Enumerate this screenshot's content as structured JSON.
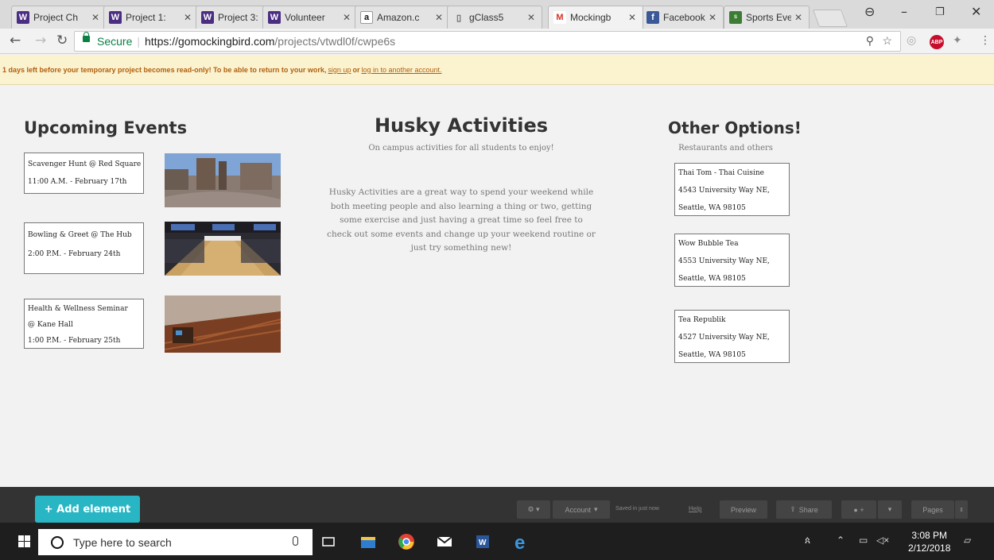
{
  "browser": {
    "tabs": [
      {
        "title": "Project Ch",
        "icon": "uw-w-icon"
      },
      {
        "title": "Project 1:",
        "icon": "uw-w-icon"
      },
      {
        "title": "Project 3:",
        "icon": "uw-w-icon"
      },
      {
        "title": "Volunteer",
        "icon": "uw-w-icon"
      },
      {
        "title": "Amazon.c",
        "icon": "amazon-icon"
      },
      {
        "title": "gClass5",
        "icon": "document-icon"
      },
      {
        "title": "Mockingb",
        "icon": "gmail-icon"
      },
      {
        "title": "Facebook",
        "icon": "facebook-icon"
      },
      {
        "title": "Sports Eve",
        "icon": "sports-icon"
      }
    ],
    "address": {
      "secure_label": "Secure",
      "url_host": "https://gomockingbird.com",
      "url_path": "/projects/vtwdl0f/cwpe6s"
    }
  },
  "banner": {
    "message": "1 days left before your temporary project becomes read-only! To be able to return to your work,",
    "signup": "sign up",
    "or": "or",
    "login": "log in to another account."
  },
  "page": {
    "left_heading": "Upcoming Events",
    "center_heading": "Husky Activities",
    "center_subheading": "On campus activities for all students to enjoy!",
    "center_body": "Husky Activities are a great way to spend your weekend while both meeting people and also learning a thing or two, getting some exercise and just having a great time so feel free to check out some events and change up your weekend routine or just try something new!",
    "right_heading": "Other Options!",
    "right_subheading": "Restaurants and others",
    "events": [
      {
        "line1": "Scavenger Hunt @ Red Square",
        "line2": "11:00 A.M. - February 17th"
      },
      {
        "line1": "Bowling & Greet @ The Hub",
        "line2": "",
        "line3": "2:00 P.M. - February 24th"
      },
      {
        "line1": "Health & Wellness Seminar",
        "line2": "@ Kane Hall",
        "line3": "1:00 P.M. - February 25th"
      }
    ],
    "options": [
      {
        "name": "Thai Tom - Thai Cuisine",
        "address": "4543 University Way NE,",
        "city": "Seattle, WA 98105"
      },
      {
        "name": "Wow Bubble Tea",
        "address": "4553 University Way NE,",
        "city": "Seattle, WA 98105"
      },
      {
        "name": "Tea Republik",
        "address": "4527 University Way NE,",
        "city": "Seattle, WA 98105"
      }
    ]
  },
  "editor": {
    "add_element": "+ Add element",
    "account": "Account",
    "saved": "Saved in just now",
    "help": "Help",
    "preview": "Preview",
    "share": "Share",
    "pages": "Pages"
  },
  "taskbar": {
    "search_placeholder": "Type here to search",
    "time": "3:08 PM",
    "date": "2/12/2018"
  }
}
